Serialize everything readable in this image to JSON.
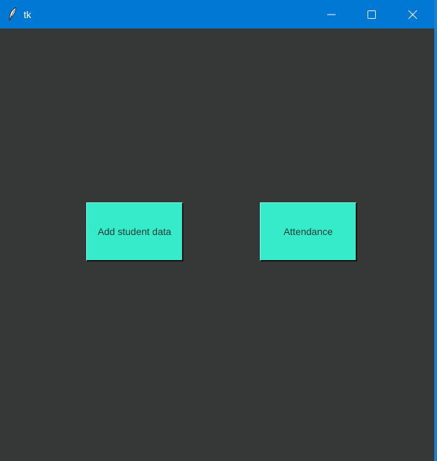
{
  "window": {
    "title": "tk",
    "controls": {
      "minimize_icon": "minimize-icon",
      "maximize_icon": "maximize-icon",
      "close_icon": "close-icon"
    }
  },
  "main": {
    "buttons": [
      {
        "label": "Add student data"
      },
      {
        "label": "Attendance"
      }
    ]
  },
  "colors": {
    "titlebar": "#0078d4",
    "background": "#363837",
    "button_bg": "#36ebc9",
    "button_text": "#1f3a36"
  }
}
